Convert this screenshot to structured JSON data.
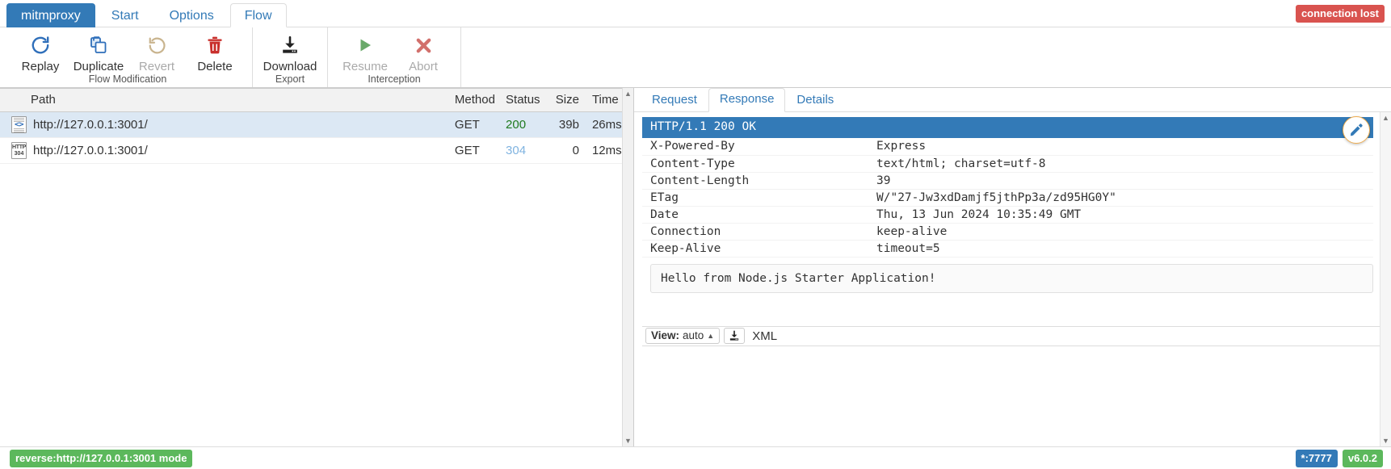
{
  "header": {
    "brand": "mitmproxy",
    "tabs": [
      {
        "label": "mitmproxy",
        "kind": "brand"
      },
      {
        "label": "Start",
        "kind": "normal"
      },
      {
        "label": "Options",
        "kind": "normal"
      },
      {
        "label": "Flow",
        "kind": "active"
      }
    ],
    "connection_badge": "connection lost",
    "connection_badge_color": "#d9534f"
  },
  "toolbar": {
    "groups": [
      {
        "label": "Flow Modification",
        "buttons": [
          {
            "label": "Replay",
            "icon": "replay-icon",
            "disabled": false
          },
          {
            "label": "Duplicate",
            "icon": "duplicate-icon",
            "disabled": false
          },
          {
            "label": "Revert",
            "icon": "revert-icon",
            "disabled": true
          },
          {
            "label": "Delete",
            "icon": "delete-icon",
            "disabled": false
          }
        ]
      },
      {
        "label": "Export",
        "buttons": [
          {
            "label": "Download",
            "icon": "download-icon",
            "disabled": false
          }
        ]
      },
      {
        "label": "Interception",
        "buttons": [
          {
            "label": "Resume",
            "icon": "play-icon",
            "disabled": true
          },
          {
            "label": "Abort",
            "icon": "abort-icon",
            "disabled": true
          }
        ]
      }
    ]
  },
  "flow_table": {
    "columns": [
      {
        "key": "path",
        "label": "Path",
        "align": "left"
      },
      {
        "key": "method",
        "label": "Method",
        "align": "left"
      },
      {
        "key": "status",
        "label": "Status",
        "align": "left"
      },
      {
        "key": "size",
        "label": "Size",
        "align": "right"
      },
      {
        "key": "time",
        "label": "Time",
        "align": "right"
      }
    ],
    "rows": [
      {
        "icon": "html-document-icon",
        "path": "http://127.0.0.1:3001/",
        "method": "GET",
        "status": "200",
        "status_class": "status-200",
        "size": "39b",
        "time": "26ms",
        "selected": true
      },
      {
        "icon": "http-304-icon",
        "icon_line1": "HTTP",
        "icon_line2": "304",
        "path": "http://127.0.0.1:3001/",
        "method": "GET",
        "status": "304",
        "status_class": "status-304",
        "size": "0",
        "time": "12ms",
        "selected": false
      }
    ]
  },
  "detail": {
    "tabs": [
      {
        "label": "Request",
        "active": false
      },
      {
        "label": "Response",
        "active": true
      },
      {
        "label": "Details",
        "active": false
      }
    ],
    "status_line": "HTTP/1.1 200 OK",
    "status_line_bg": "#337ab7",
    "headers": [
      {
        "name": "X-Powered-By",
        "value": "Express"
      },
      {
        "name": "Content-Type",
        "value": "text/html; charset=utf-8"
      },
      {
        "name": "Content-Length",
        "value": "39"
      },
      {
        "name": "ETag",
        "value": "W/\"27-Jw3xdDamjf5jthPp3a/zd95HG0Y\""
      },
      {
        "name": "Date",
        "value": "Thu, 13 Jun 2024 10:35:49 GMT"
      },
      {
        "name": "Connection",
        "value": "keep-alive"
      },
      {
        "name": "Keep-Alive",
        "value": "timeout=5"
      }
    ],
    "body": "Hello from Node.js Starter Application!",
    "view_bar": {
      "view_label": "View:",
      "view_value": "auto",
      "caret": "▲",
      "download_icon": "download-icon",
      "content_type": "XML"
    },
    "edit_button_icon": "pencil-icon"
  },
  "statusbar": {
    "mode": "reverse:http://127.0.0.1:3001 mode",
    "mode_color": "#5cb85c",
    "port": "*:7777",
    "port_color": "#337ab7",
    "version": "v6.0.2",
    "version_color": "#5cb85c"
  }
}
